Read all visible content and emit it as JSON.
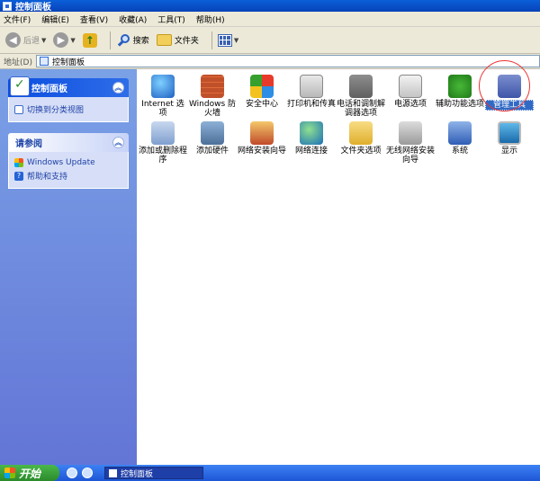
{
  "window": {
    "title": "控制面板"
  },
  "menubar": [
    "文件(F)",
    "编辑(E)",
    "查看(V)",
    "收藏(A)",
    "工具(T)",
    "帮助(H)"
  ],
  "toolbar": {
    "back": "后退",
    "search": "搜索",
    "folders": "文件夹"
  },
  "address": {
    "label": "地址(D)",
    "value": "控制面板"
  },
  "leftpane": {
    "panel1": {
      "title": "控制面板",
      "link": "切换到分类视图"
    },
    "panel2": {
      "title": "请参阅",
      "links": [
        "Windows Update",
        "帮助和支持"
      ]
    }
  },
  "items": [
    {
      "label": "Internet 选项",
      "icon": "internet-options-icon"
    },
    {
      "label": "Windows 防火墙",
      "icon": "firewall-icon"
    },
    {
      "label": "安全中心",
      "icon": "security-center-icon"
    },
    {
      "label": "打印机和传真",
      "icon": "printer-icon"
    },
    {
      "label": "电话和调制解调器选项",
      "icon": "phone-modem-icon"
    },
    {
      "label": "电源选项",
      "icon": "power-options-icon"
    },
    {
      "label": "辅助功能选项",
      "icon": "accessibility-icon"
    },
    {
      "label": "管理工具",
      "icon": "admin-tools-icon",
      "selected": true
    },
    {
      "label": "添加或删除程序",
      "icon": "add-remove-programs-icon"
    },
    {
      "label": "添加硬件",
      "icon": "add-hardware-icon"
    },
    {
      "label": "网络安装向导",
      "icon": "network-setup-wizard-icon"
    },
    {
      "label": "网络连接",
      "icon": "network-connections-icon"
    },
    {
      "label": "文件夹选项",
      "icon": "folder-options-icon"
    },
    {
      "label": "无线网络安装向导",
      "icon": "wireless-wizard-icon"
    },
    {
      "label": "系统",
      "icon": "system-icon"
    },
    {
      "label": "显示",
      "icon": "display-icon"
    }
  ],
  "taskbar": {
    "start": "开始",
    "task": "控制面板"
  },
  "colors": {
    "selection": "#316ac5",
    "highlight_ring": "#e33333"
  }
}
